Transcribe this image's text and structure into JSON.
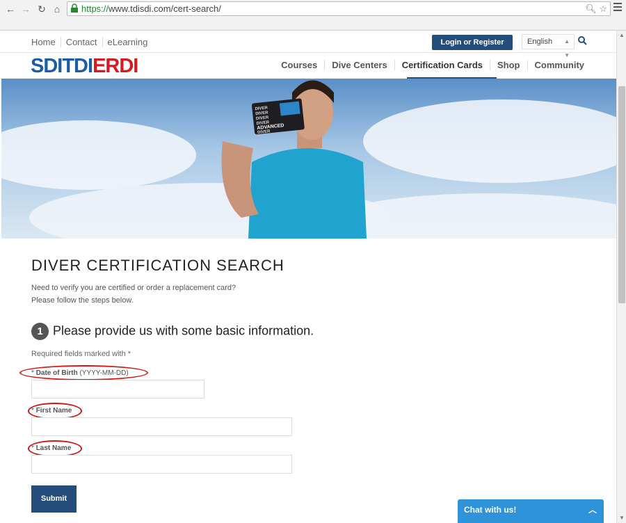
{
  "browser": {
    "url_scheme": "https://",
    "url_rest": "www.tdisdi.com/cert-search/"
  },
  "topbar": {
    "links": [
      "Home",
      "Contact",
      "eLearning"
    ],
    "login_label": "Login or Register",
    "language": "English"
  },
  "logo": {
    "sdi": "SDI",
    "tdi": "TDI",
    "erdi": "ERDI"
  },
  "nav": {
    "items": [
      "Courses",
      "Dive Centers",
      "Certification Cards",
      "Shop",
      "Community"
    ],
    "active": "Certification Cards"
  },
  "hero": {
    "card_lines": [
      "DIVER",
      "DIVER",
      "DIVER",
      "DIVER",
      "ADVANCED",
      "DIVER"
    ]
  },
  "content": {
    "title": "DIVER CERTIFICATION SEARCH",
    "intro_line1": "Need to verify you are certified or order a replacement card?",
    "intro_line2": "Please follow the steps below.",
    "step_number": "1",
    "step_title": "Please provide us with some basic information.",
    "required_note": "Required fields marked with *"
  },
  "form": {
    "dob_label": "Date of Birth",
    "dob_hint": "(YYYY-MM-DD)",
    "first_name_label": "First Name",
    "last_name_label": "Last Name",
    "required_marker": "*",
    "submit_label": "Submit"
  },
  "chat": {
    "label": "Chat with us!"
  },
  "colors": {
    "brand_blue": "#244d7c",
    "annotation_red": "#d01818",
    "chat_blue": "#2e93d8"
  }
}
